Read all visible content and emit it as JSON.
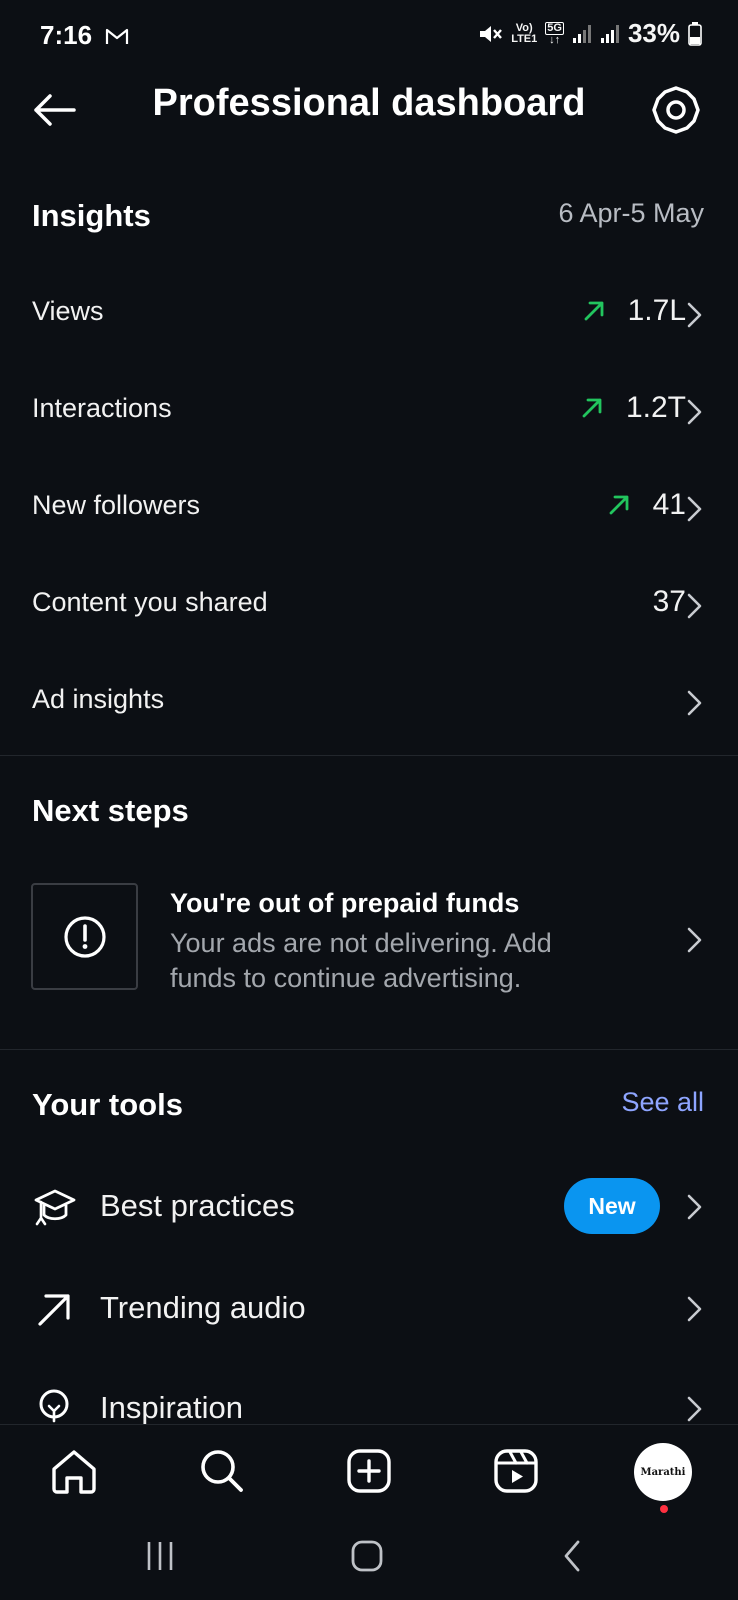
{
  "status_bar": {
    "time": "7:16",
    "battery": "33%",
    "net_vo": "Vo)",
    "net_lte": "LTE1",
    "net_5g": "5G"
  },
  "header": {
    "title": "Professional dashboard"
  },
  "insights": {
    "title": "Insights",
    "date_range": "6 Apr-5 May",
    "rows": [
      {
        "label": "Views",
        "value": "1.7L",
        "trend": "up"
      },
      {
        "label": "Interactions",
        "value": "1.2T",
        "trend": "up"
      },
      {
        "label": "New followers",
        "value": "41",
        "trend": "up"
      },
      {
        "label": "Content you shared",
        "value": "37"
      },
      {
        "label": "Ad insights",
        "value": ""
      }
    ]
  },
  "next_steps": {
    "title": "Next steps",
    "notice_title": "You're out of prepaid funds",
    "notice_desc": "Your ads are not delivering. Add funds to continue advertising."
  },
  "tools": {
    "title": "Your tools",
    "see_all": "See all",
    "items": [
      {
        "label": "Best practices",
        "badge": "New",
        "icon": "graduation-cap-icon"
      },
      {
        "label": "Trending audio",
        "icon": "trending-arrow-icon"
      },
      {
        "label": "Inspiration",
        "icon": "lightbulb-icon"
      }
    ]
  },
  "bottom_nav": {
    "avatar_text": "Marathi"
  },
  "colors": {
    "background": "#0c0f14",
    "trend_up": "#22c55e",
    "link": "#8ea5ff",
    "badge": "#0a95f0"
  }
}
